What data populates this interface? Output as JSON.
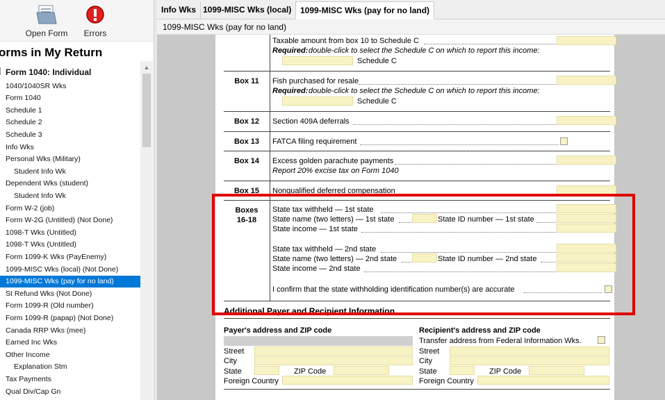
{
  "toolbar": {
    "open_form": "Open Form",
    "errors": "Errors"
  },
  "left": {
    "title": "orms in My Return",
    "items": [
      {
        "label": "Form 1040:  Individual",
        "type": "header"
      },
      {
        "label": "1040/1040SR Wks"
      },
      {
        "label": "Form 1040"
      },
      {
        "label": "Schedule 1"
      },
      {
        "label": "Schedule 2"
      },
      {
        "label": "Schedule 3"
      },
      {
        "label": "Info Wks"
      },
      {
        "label": "Personal Wks (Military)"
      },
      {
        "label": "Student Info Wk",
        "type": "child"
      },
      {
        "label": "Dependent Wks (student)"
      },
      {
        "label": "Student Info Wk",
        "type": "child"
      },
      {
        "label": "Form W-2 (job)"
      },
      {
        "label": "Form W-2G (Untitled) (Not Done)"
      },
      {
        "label": "1098-T Wks (Untitled)"
      },
      {
        "label": "1098-T Wks (Untitled)"
      },
      {
        "label": "Form 1099-K Wks (PayEnemy)"
      },
      {
        "label": "1099-MISC Wks (local) (Not Done)"
      },
      {
        "label": "1099-MISC Wks (pay for no land)",
        "type": "selected"
      },
      {
        "label": "St Refund Wks (Not Done)"
      },
      {
        "label": "Form 1099-R (Old number)"
      },
      {
        "label": "Form 1099-R (papap) (Not Done)"
      },
      {
        "label": "Canada RRP Wks (mee)"
      },
      {
        "label": "Earned Inc Wks"
      },
      {
        "label": "Other Income"
      },
      {
        "label": "Explanation Stm",
        "type": "child"
      },
      {
        "label": "Tax Payments"
      },
      {
        "label": "Qual Div/Cap Gn"
      }
    ]
  },
  "tabs": [
    "Info Wks",
    "1099-MISC Wks (local)",
    "1099-MISC Wks (pay for no land)"
  ],
  "breadcrumb": "1099-MISC Wks (pay for no land)",
  "form": {
    "box10": {
      "line1": "Taxable amount from box 10 to Schedule C",
      "required": "Required:",
      "req_text": "double-click to select the Schedule C on which to report this income:",
      "schedule": "Schedule C"
    },
    "box11": {
      "label": "Box 11",
      "line1": "Fish purchased for resale",
      "required": "Required:",
      "req_text": "double-click to select the Schedule C on which to report this income:",
      "schedule": "Schedule C"
    },
    "box12": {
      "label": "Box 12",
      "line1": "Section 409A deferrals"
    },
    "box13": {
      "label": "Box 13",
      "line1": "FATCA filing requirement"
    },
    "box14": {
      "label": "Box 14",
      "line1": "Excess golden parachute payments",
      "line2": "Report 20% excise tax on Form 1040"
    },
    "box15": {
      "label": "Box 15",
      "line1": "Nonqualified deferred compensation"
    },
    "boxes16": {
      "label1": "Boxes",
      "label2": "16-18",
      "tax1": "State tax withheld — 1st state",
      "name1": "State name (two letters) — 1st state",
      "id1": "State ID number — 1st state",
      "inc1": "State income — 1st state",
      "tax2": "State tax withheld — 2nd state",
      "name2": "State name (two letters) — 2nd state",
      "id2": "State ID number — 2nd state",
      "inc2": "State income — 2nd state",
      "confirm": "I confirm that the state withholding identification number(s) are accurate"
    },
    "additional": {
      "heading": "Additional Payer and Recipient Information",
      "payer_heading": "Payer's address and ZIP code",
      "recipient_heading": "Recipient's  address and ZIP code",
      "transfer": "Transfer address from Federal Information Wks.",
      "street": "Street",
      "city": "City",
      "state": "State",
      "zip": "ZIP Code",
      "country": "Foreign Country"
    }
  },
  "colors": {
    "selected": "#0078d7",
    "field": "#f8f3c4",
    "highlight": "#e00000"
  }
}
